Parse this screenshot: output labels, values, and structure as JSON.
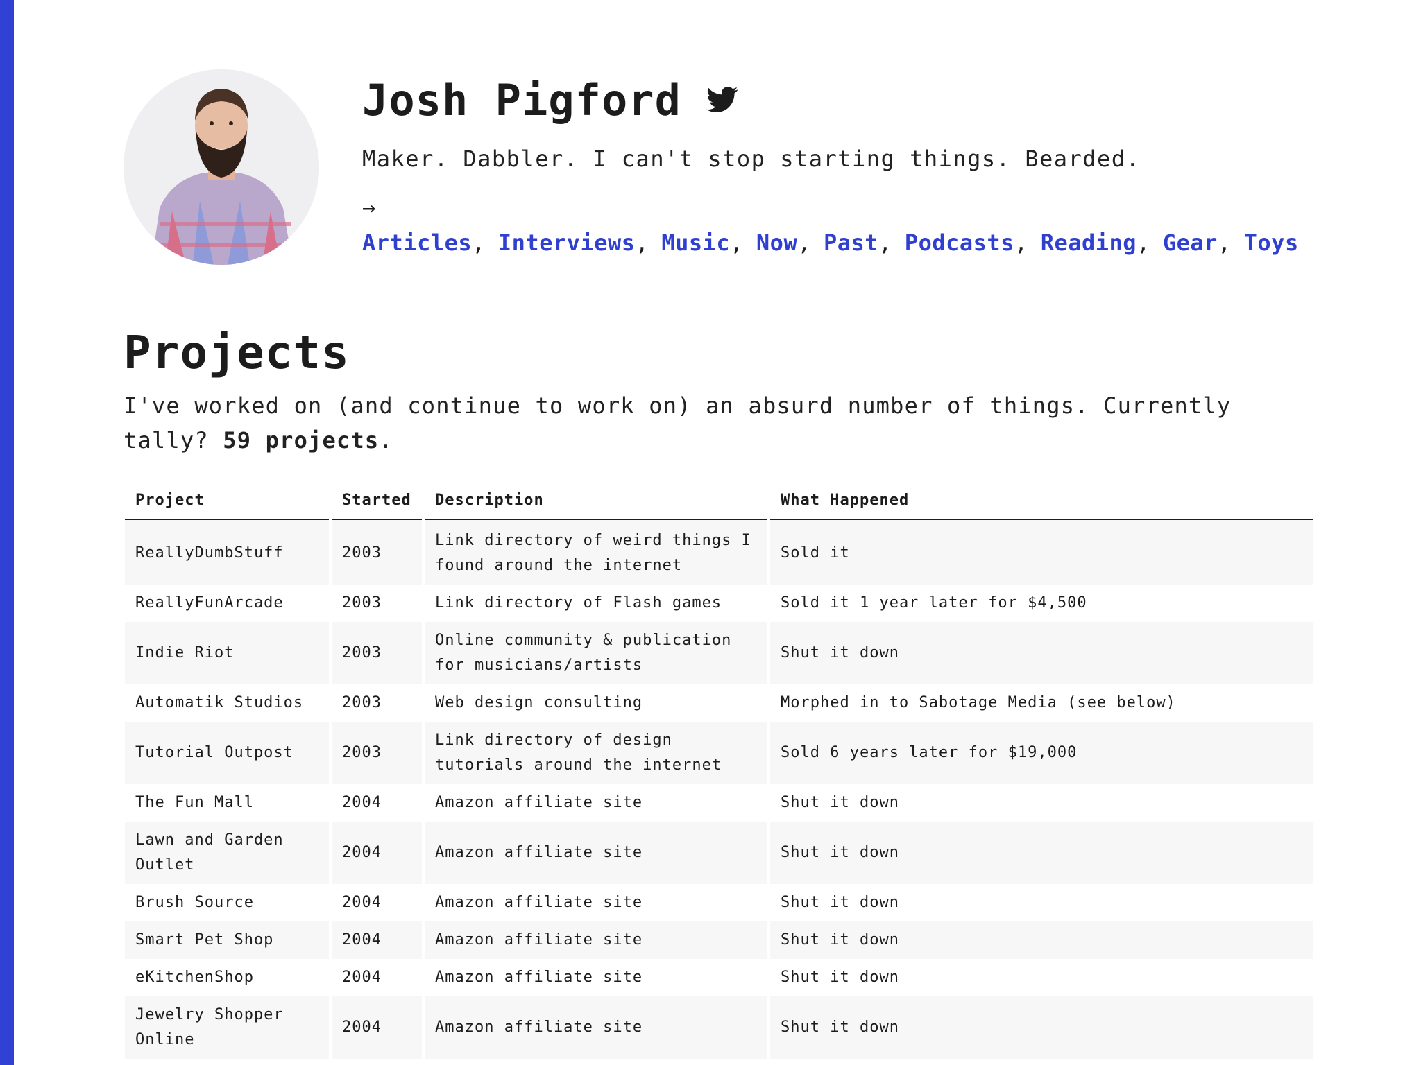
{
  "profile": {
    "name": "Josh Pigford",
    "tagline": "Maker. Dabbler. I can't stop starting things. Bearded.",
    "nav_arrow": "→",
    "nav_links": [
      "Articles",
      "Interviews",
      "Music",
      "Now",
      "Past",
      "Podcasts",
      "Reading",
      "Gear",
      "Toys"
    ],
    "separator": ","
  },
  "projects": {
    "title": "Projects",
    "description": "I've worked on (and continue to work on) an absurd number of things. Currently tally?",
    "tally": "59 projects",
    "tally_suffix": ".",
    "columns": [
      "Project",
      "Started",
      "Description",
      "What Happened"
    ],
    "rows": [
      [
        "ReallyDumbStuff",
        "2003",
        "Link directory of weird things I found around the internet",
        "Sold it"
      ],
      [
        "ReallyFunArcade",
        "2003",
        "Link directory of Flash games",
        "Sold it 1 year later for $4,500"
      ],
      [
        "Indie Riot",
        "2003",
        "Online community & publication for musicians/artists",
        "Shut it down"
      ],
      [
        "Automatik Studios",
        "2003",
        "Web design consulting",
        "Morphed in to Sabotage Media (see below)"
      ],
      [
        "Tutorial Outpost",
        "2003",
        "Link directory of design tutorials around the internet",
        "Sold 6 years later for $19,000"
      ],
      [
        "The Fun Mall",
        "2004",
        "Amazon affiliate site",
        "Shut it down"
      ],
      [
        "Lawn and Garden Outlet",
        "2004",
        "Amazon affiliate site",
        "Shut it down"
      ],
      [
        "Brush Source",
        "2004",
        "Amazon affiliate site",
        "Shut it down"
      ],
      [
        "Smart Pet Shop",
        "2004",
        "Amazon affiliate site",
        "Shut it down"
      ],
      [
        "eKitchenShop",
        "2004",
        "Amazon affiliate site",
        "Shut it down"
      ],
      [
        "Jewelry Shopper Online",
        "2004",
        "Amazon affiliate site",
        "Shut it down"
      ]
    ]
  },
  "colors": {
    "accent": "#3041d4",
    "link": "#2f3fd0",
    "text": "#1c1c1c",
    "row_alt": "#f7f7f7"
  },
  "icons": {
    "twitter": "twitter-icon"
  }
}
